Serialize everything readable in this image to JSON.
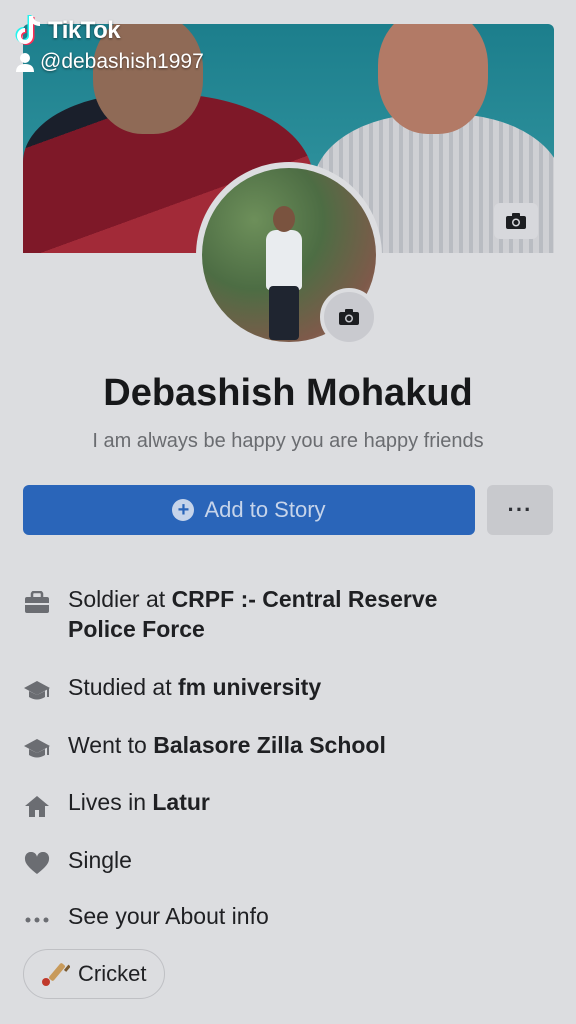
{
  "watermark": {
    "brand": "TikTok",
    "username": "@debashish1997"
  },
  "profile": {
    "name": "Debashish Mohakud",
    "bio": "I am always be happy you are happy  friends"
  },
  "actions": {
    "add_story_label": "Add to Story",
    "more_label": "···"
  },
  "info": [
    {
      "prefix": "Soldier at ",
      "bold": "CRPF :- Central Reserve Police Force",
      "icon": "briefcase-icon"
    },
    {
      "prefix": "Studied at ",
      "bold": "fm university",
      "icon": "graduation-cap-icon"
    },
    {
      "prefix": "Went to ",
      "bold": "Balasore Zilla School",
      "icon": "graduation-cap-icon"
    },
    {
      "prefix": "Lives in ",
      "bold": "Latur",
      "icon": "home-icon"
    },
    {
      "prefix": "Single",
      "bold": "",
      "icon": "heart-icon"
    },
    {
      "prefix": "See your About info",
      "bold": "",
      "icon": "more-dots-icon"
    }
  ],
  "hobby": {
    "label": "Cricket",
    "icon": "cricket-icon"
  }
}
